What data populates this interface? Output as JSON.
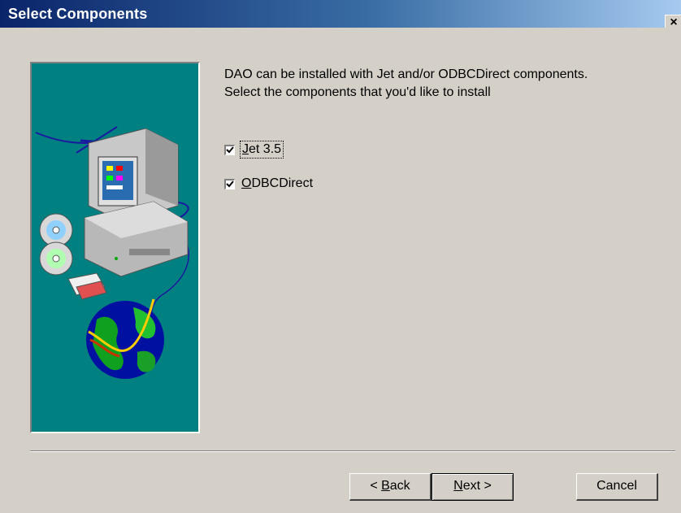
{
  "window": {
    "title": "Select Components",
    "close_label": "×"
  },
  "description": {
    "line1": "DAO can be installed with Jet and/or ODBCDirect components.",
    "line2": "Select the components that you'd like to install"
  },
  "components": [
    {
      "label_prefix": "",
      "mnemonic": "J",
      "label_rest": "et 3.5",
      "checked": true
    },
    {
      "label_prefix": "",
      "mnemonic": "O",
      "label_rest": "DBCDirect",
      "checked": true
    }
  ],
  "buttons": {
    "back": {
      "prefix": "< ",
      "mnemonic": "B",
      "rest": "ack"
    },
    "next": {
      "prefix": "",
      "mnemonic": "N",
      "rest": "ext >"
    },
    "cancel": "Cancel"
  },
  "colors": {
    "titlebar_start": "#0a246a",
    "titlebar_end": "#a6caf0",
    "picture_bg": "#008080",
    "dialog_bg": "#d4d0c8"
  },
  "icons": {
    "wizard_picture": "computer-cds-globe-network-illustration",
    "checkbox_mark": "checkmark-icon",
    "close": "close-icon"
  }
}
